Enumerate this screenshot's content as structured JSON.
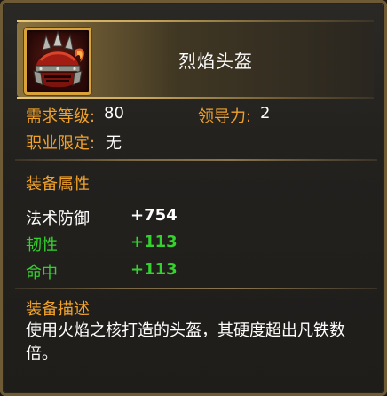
{
  "item": {
    "name": "烈焰头盔",
    "icon": "flame-helmet-icon"
  },
  "requirements": {
    "level_label": "需求等级:",
    "level_value": "80",
    "leadership_label": "领导力:",
    "leadership_value": "2",
    "class_label": "职业限定:",
    "class_value": "无"
  },
  "attributes": {
    "section_title": "装备属性",
    "rows": [
      {
        "label": "法术防御",
        "value": "+754"
      },
      {
        "label": "韧性",
        "value": "+113"
      },
      {
        "label": "命中",
        "value": "+113"
      }
    ]
  },
  "description": {
    "section_title": "装备描述",
    "text": "使用火焰之核打造的头盔，其硬度超出凡铁数倍。"
  },
  "colors": {
    "gold_label": "#f0a12c",
    "green_stat": "#35d12f",
    "white_text": "#ffffff",
    "frame_gold": "#d9a33a"
  }
}
